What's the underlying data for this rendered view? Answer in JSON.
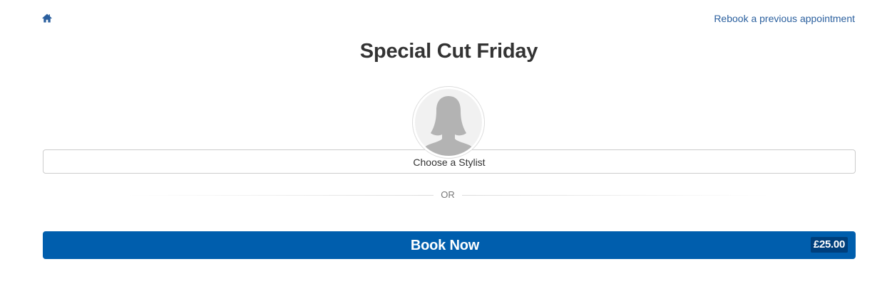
{
  "header": {
    "home_icon": "home-icon",
    "rebook_link": "Rebook a previous appointment"
  },
  "main": {
    "title": "Special Cut Friday",
    "stylist": {
      "avatar_icon": "person-silhouette-icon",
      "label": "Choose a Stylist"
    },
    "divider_text": "OR",
    "book_button": {
      "label": "Book Now",
      "price": "£25.00"
    }
  },
  "colors": {
    "link": "#2a5f9e",
    "primary_button": "#005ead",
    "price_badge": "#003f7c",
    "avatar_silhouette": "#b3b3b3"
  }
}
